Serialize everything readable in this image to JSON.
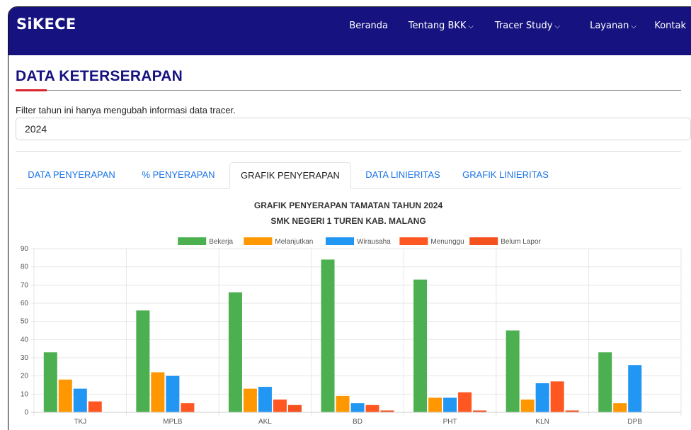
{
  "brand": "SiKECE",
  "nav": [
    {
      "label": "Beranda",
      "dropdown": false
    },
    {
      "label": "Tentang BKK",
      "dropdown": true
    },
    {
      "label": "Tracer Study",
      "dropdown": true
    },
    {
      "label": "Layanan",
      "dropdown": true
    },
    {
      "label": "Kontak",
      "dropdown": false
    }
  ],
  "page_title": "DATA KETERSERAPAN",
  "filter": {
    "label": "Filter tahun ini hanya mengubah informasi data tracer.",
    "value": "2024"
  },
  "tabs": [
    {
      "label": "DATA PENYERAPAN",
      "active": false
    },
    {
      "label": "% PENYERAPAN",
      "active": false
    },
    {
      "label": "GRAFIK PENYERAPAN",
      "active": true
    },
    {
      "label": "DATA LINIERITAS",
      "active": false
    },
    {
      "label": "GRAFIK LINIERITAS",
      "active": false
    }
  ],
  "colors": {
    "navbar": "#161380",
    "link": "#1a73e8",
    "accent": "#d9232d"
  },
  "chart_data": {
    "type": "bar",
    "title": "GRAFIK PENYERAPAN TAMATAN TAHUN 2024",
    "subtitle": "SMK NEGERI 1 TUREN KAB. MALANG",
    "categories": [
      "TKJ",
      "MPLB",
      "AKL",
      "BD",
      "PHT",
      "KLN",
      "DPB"
    ],
    "ylim": [
      0,
      90
    ],
    "yticks": [
      0,
      10,
      20,
      30,
      40,
      50,
      60,
      70,
      80,
      90
    ],
    "grid": true,
    "legend": "top",
    "series": [
      {
        "name": "Bekerja",
        "color": "#4caf50",
        "values": [
          33,
          56,
          66,
          84,
          73,
          45,
          33
        ]
      },
      {
        "name": "Melanjutkan",
        "color": "#ff9800",
        "values": [
          18,
          22,
          13,
          9,
          8,
          7,
          5
        ]
      },
      {
        "name": "Wirausaha",
        "color": "#2196f3",
        "values": [
          13,
          20,
          14,
          5,
          8,
          16,
          26
        ]
      },
      {
        "name": "Menunggu",
        "color": "#ff5722",
        "values": [
          6,
          5,
          7,
          4,
          11,
          17,
          0
        ]
      },
      {
        "name": "Belum Lapor",
        "color": "#f4511e",
        "values": [
          0,
          0,
          4,
          1,
          1,
          1,
          0
        ]
      }
    ]
  }
}
